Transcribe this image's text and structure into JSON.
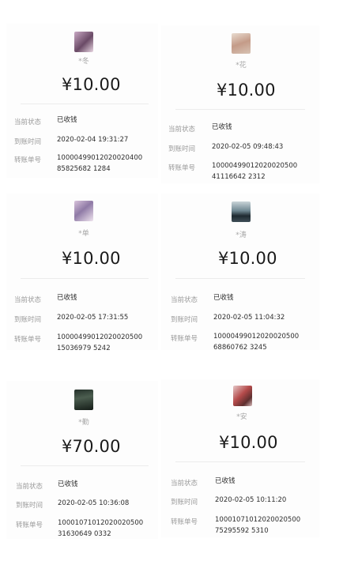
{
  "labels": {
    "status": "当前状态",
    "arrival_time": "到账时间",
    "transfer_no": "转账单号"
  },
  "cards": [
    {
      "name": "*冬",
      "amount": "¥10.00",
      "status": "已收钱",
      "time": "2020-02-04 19:31:27",
      "transfer_no": "1000049901202002040085825682 1284"
    },
    {
      "name": "*花",
      "amount": "¥10.00",
      "status": "已收钱",
      "time": "2020-02-05 09:48:43",
      "transfer_no": "1000049901202002050041116642 2312"
    },
    {
      "name": "*单",
      "amount": "¥10.00",
      "status": "已收钱",
      "time": "2020-02-05 17:31:55",
      "transfer_no": "1000049901202002050015036979 5242"
    },
    {
      "name": "*涛",
      "amount": "¥10.00",
      "status": "已收钱",
      "time": "2020-02-05 11:04:32",
      "transfer_no": "1000049901202002050068860762 3245"
    },
    {
      "name": "*勤",
      "amount": "¥70.00",
      "status": "已收钱",
      "time": "2020-02-05 10:36:08",
      "transfer_no": "1000107101202002050031630649 0332"
    },
    {
      "name": "*安",
      "amount": "¥10.00",
      "status": "已收钱",
      "time": "2020-02-05 10:11:20",
      "transfer_no": "1000107101202002050075295592 5310"
    }
  ]
}
